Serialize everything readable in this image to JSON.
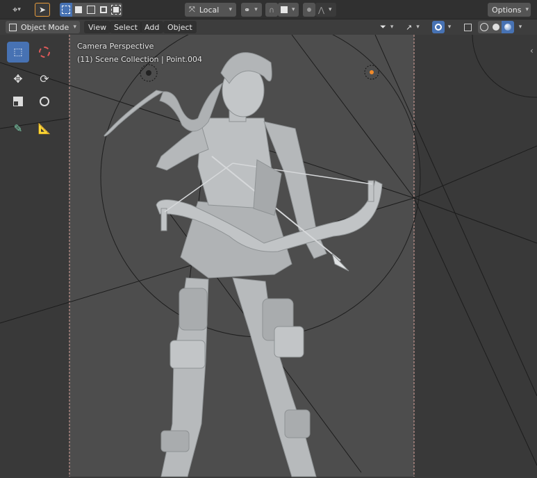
{
  "header": {
    "transform_pivot": "Local",
    "options_label": "Options"
  },
  "menubar": {
    "mode": "Object Mode",
    "items": [
      "View",
      "Select",
      "Add",
      "Object"
    ]
  },
  "viewport": {
    "camera_label": "Camera Perspective",
    "collection_label": "(11) Scene Collection | Point.004"
  },
  "icons": {
    "editor_type": "editor-type-icon",
    "select_tool": "cursor-arrow-icon",
    "select_modes": [
      "select-box-new-icon",
      "select-box-extend-icon",
      "select-box-subtract-icon",
      "select-box-difference-icon",
      "select-box-intersect-icon"
    ],
    "snap": "magnet-icon",
    "overlays": "overlays-icon",
    "shading": [
      "wireframe-icon",
      "solid-icon",
      "material-preview-icon"
    ]
  },
  "colors": {
    "active": "#4772b3",
    "header": "#303030",
    "viewport": "#3d3d3d",
    "passepartout": "#4a4a4a",
    "model": "#b9bcbe"
  }
}
